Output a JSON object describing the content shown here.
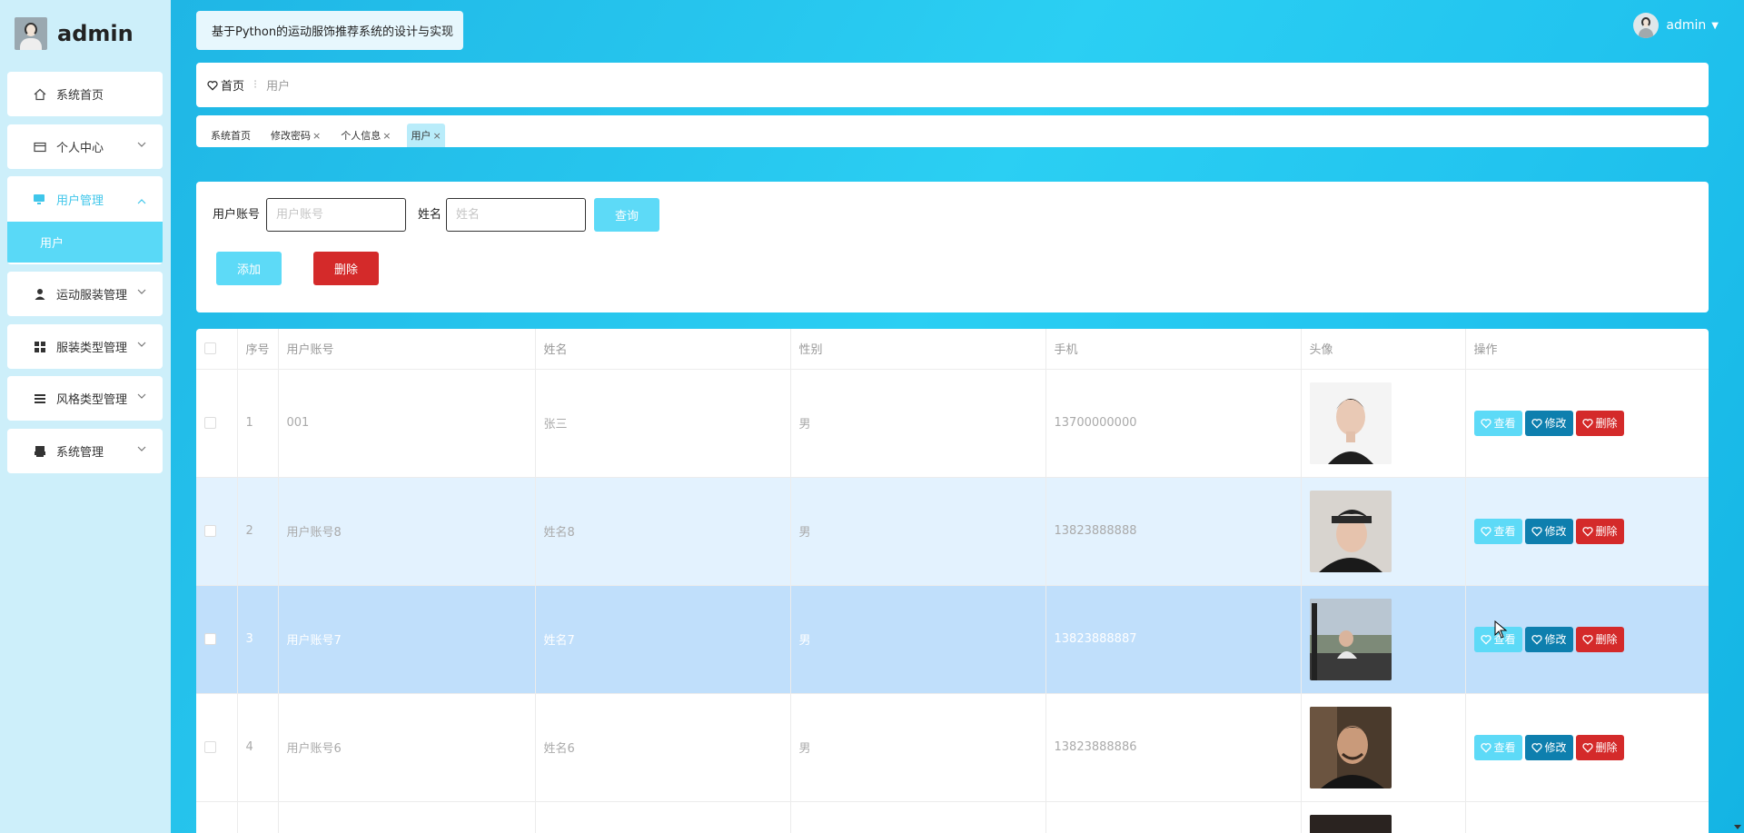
{
  "sidebar": {
    "brand": "admin",
    "menu": [
      {
        "label": "系统首页",
        "icon": "home-icon"
      },
      {
        "label": "个人中心",
        "icon": "wallet-icon"
      },
      {
        "label": "用户管理",
        "icon": "monitor-icon",
        "open": true,
        "children": [
          "用户"
        ]
      },
      {
        "label": "运动服装管理",
        "icon": "person-icon"
      },
      {
        "label": "服装类型管理",
        "icon": "grid-icon"
      },
      {
        "label": "风格类型管理",
        "icon": "list-icon"
      },
      {
        "label": "系统管理",
        "icon": "printer-icon"
      }
    ]
  },
  "header": {
    "title": "基于Python的运动服饰推荐系统的设计与实现",
    "user": "admin"
  },
  "breadcrumb": {
    "home": "首页",
    "current": "用户"
  },
  "tabs": [
    {
      "label": "系统首页",
      "closable": false
    },
    {
      "label": "修改密码",
      "closable": true
    },
    {
      "label": "个人信息",
      "closable": true
    },
    {
      "label": "用户",
      "closable": true,
      "active": true
    }
  ],
  "search": {
    "account_label": "用户账号",
    "account_placeholder": "用户账号",
    "name_label": "姓名",
    "name_placeholder": "姓名",
    "query_button": "查询",
    "add_button": "添加",
    "delete_button": "删除"
  },
  "table": {
    "columns": [
      "序号",
      "用户账号",
      "姓名",
      "性别",
      "手机",
      "头像",
      "操作"
    ],
    "rows": [
      {
        "index": "1",
        "account": "001",
        "name": "张三",
        "gender": "男",
        "phone": "13700000000"
      },
      {
        "index": "2",
        "account": "用户账号8",
        "name": "姓名8",
        "gender": "男",
        "phone": "13823888888"
      },
      {
        "index": "3",
        "account": "用户账号7",
        "name": "姓名7",
        "gender": "男",
        "phone": "13823888887"
      },
      {
        "index": "4",
        "account": "用户账号6",
        "name": "姓名6",
        "gender": "男",
        "phone": "13823888886"
      }
    ],
    "actions": {
      "view": "查看",
      "edit": "修改",
      "delete": "删除"
    }
  },
  "colors": {
    "accent": "#5ddaf7",
    "edit": "#0e7fae",
    "danger": "#d42a2a",
    "selected_row": "#c0dffb"
  }
}
